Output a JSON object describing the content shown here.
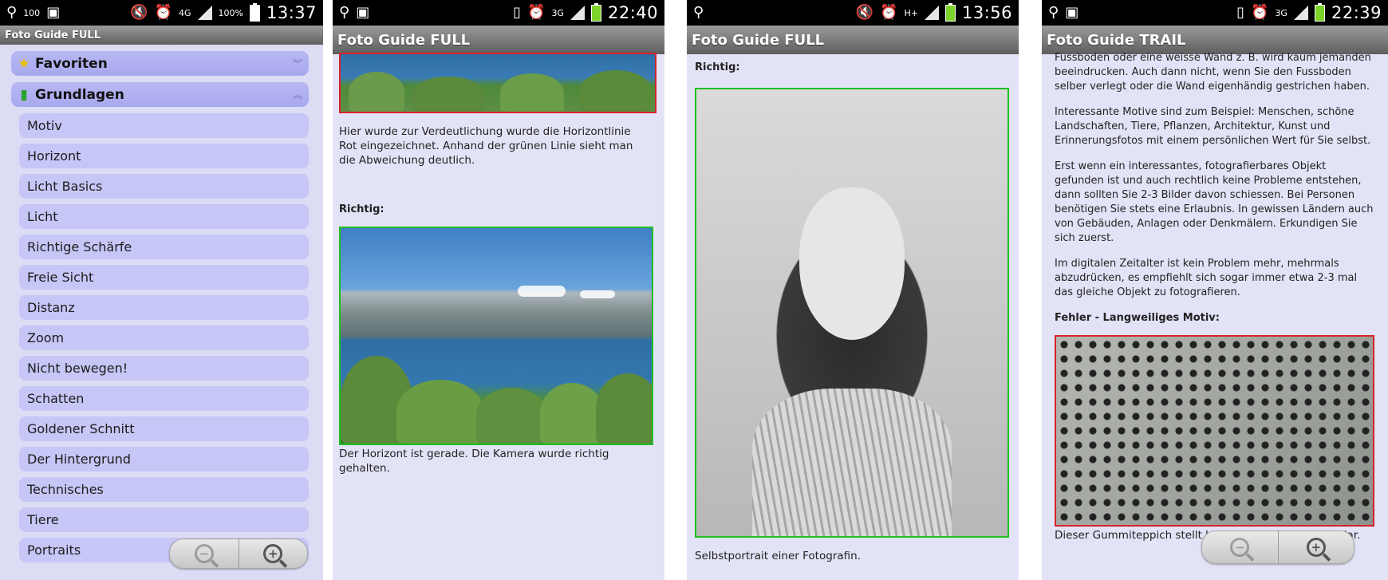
{
  "screens": [
    {
      "status": {
        "time": "13:37",
        "network": "4G",
        "battery_label": "100%",
        "notif_badge": "100"
      },
      "app_title": "Foto Guide FULL",
      "menu": {
        "groups": [
          {
            "label": "Favoriten",
            "icon": "star-icon"
          },
          {
            "label": "Grundlagen",
            "icon": "phone-icon"
          }
        ],
        "items": [
          "Motiv",
          "Horizont",
          "Licht Basics",
          "Licht",
          "Richtige Schärfe",
          "Freie Sicht",
          "Distanz",
          "Zoom",
          "Nicht bewegen!",
          "Schatten",
          "Goldener Schnitt",
          "Der Hintergrund",
          "Technisches",
          "Tiere",
          "Portraits"
        ]
      }
    },
    {
      "status": {
        "time": "22:40",
        "network": "3G"
      },
      "app_title": "Foto Guide FULL",
      "text1": "Hier wurde zur Verdeutlichung wurde die Horizontlinie Rot eingezeichnet. Anhand der grünen Linie sieht man die Abweichung deutlich.",
      "label": "Richtig:",
      "caption": "Der Horizont ist gerade. Die Kamera wurde richtig gehalten."
    },
    {
      "status": {
        "time": "13:56",
        "network": "H+"
      },
      "app_title": "Foto Guide FULL",
      "label": "Richtig:",
      "caption": "Selbstportrait einer Fotografin."
    },
    {
      "status": {
        "time": "22:39",
        "network": "3G"
      },
      "app_title": "Foto Guide TRAIL",
      "paragraphs": [
        "Fussboden oder eine weisse Wand z. B. wird kaum jemanden beeindrucken. Auch dann nicht, wenn Sie den Fussboden selber verlegt oder die Wand eigenhändig gestrichen haben.",
        "Interessante Motive sind zum Beispiel: Menschen, schöne Landschaften, Tiere, Pflanzen, Architektur, Kunst und Erinnerungsfotos mit einem persönlichen Wert für Sie selbst.",
        "Erst wenn ein interessantes, fotografierbares Objekt gefunden ist und auch rechtlich keine Probleme entstehen, dann sollten Sie 2-3 Bilder davon schiessen. Bei Personen benötigen Sie stets eine Erlaubnis. In gewissen Ländern auch von Gebäuden, Anlagen oder Denkmälern. Erkundigen Sie sich zuerst.",
        "Im digitalen Zeitalter ist kein Problem mehr, mehrmals abzudrücken, es empfiehlt sich sogar immer etwa 2-3 mal das gleiche Objekt zu fotografieren."
      ],
      "label": "Fehler - Langweiliges Motiv:",
      "caption": "Dieser Gummiteppich stellt kein interessantes Motiv dar."
    }
  ],
  "colors": {
    "status_bar": "#000000",
    "title_bar": "#7a7a7a",
    "panel_bg": "#e3e3f7",
    "menu_item": "#c6c6f7",
    "frame_red": "#d8232a",
    "frame_green": "#1fbf1f"
  }
}
